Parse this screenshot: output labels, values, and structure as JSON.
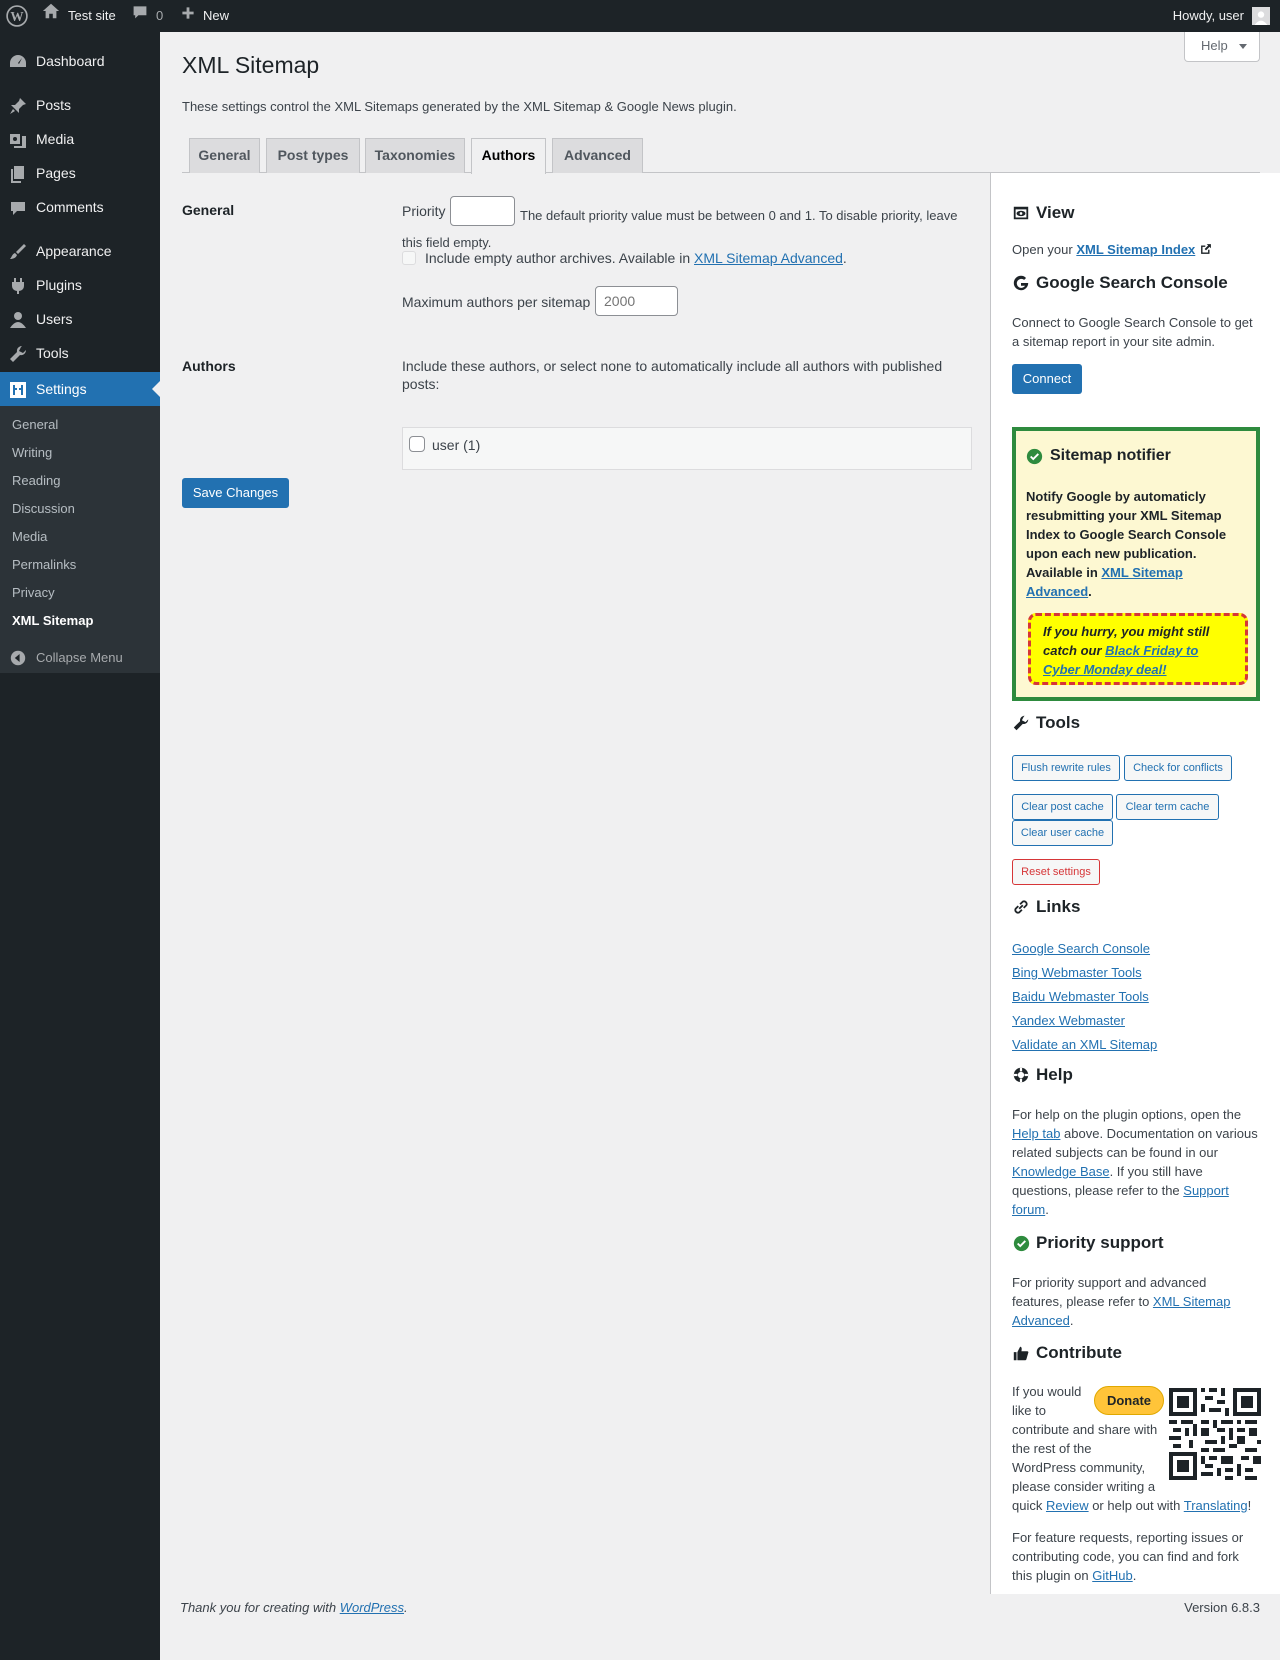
{
  "adminbar": {
    "site_name": "Test site",
    "comments_count": "0",
    "new_label": "New",
    "howdy": "Howdy, user"
  },
  "menu": {
    "items": [
      {
        "label": "Dashboard",
        "icon": "dashboard-icon"
      },
      {
        "label": "Posts",
        "icon": "pin-icon"
      },
      {
        "label": "Media",
        "icon": "media-icon"
      },
      {
        "label": "Pages",
        "icon": "pages-icon"
      },
      {
        "label": "Comments",
        "icon": "comment-icon"
      },
      {
        "label": "Appearance",
        "icon": "brush-icon"
      },
      {
        "label": "Plugins",
        "icon": "plug-icon"
      },
      {
        "label": "Users",
        "icon": "user-icon"
      },
      {
        "label": "Tools",
        "icon": "wrench-icon"
      },
      {
        "label": "Settings",
        "icon": "settings-icon"
      }
    ],
    "submenu": [
      "General",
      "Writing",
      "Reading",
      "Discussion",
      "Media",
      "Permalinks",
      "Privacy",
      "XML Sitemap"
    ],
    "collapse": "Collapse Menu"
  },
  "page": {
    "title": "XML Sitemap",
    "help": "Help",
    "intro": "These settings control the XML Sitemaps generated by the XML Sitemap & Google News plugin.",
    "tabs": [
      "General",
      "Post types",
      "Taxonomies",
      "Authors",
      "Advanced"
    ],
    "active_tab": "Authors"
  },
  "form": {
    "general_heading": "General",
    "priority_label": "Priority",
    "priority_value": "",
    "priority_desc_1": "The default priority value must be between 0 and 1. To disable priority, leave",
    "priority_desc_2": "this field empty.",
    "empty_archives_label": "Include empty author archives. Available in ",
    "empty_archives_link": "XML Sitemap Advanced",
    "empty_archives_end": ".",
    "max_label": "Maximum authors per sitemap",
    "max_placeholder": "2000",
    "authors_heading": "Authors",
    "authors_desc_1": "Include these authors, or select none to automatically include all authors with published",
    "authors_desc_2": "posts:",
    "author_item": "user (1)",
    "save": "Save Changes"
  },
  "sidebar": {
    "view_title": "View",
    "view_text": "Open your ",
    "view_link": "XML Sitemap Index",
    "gsc_title": "Google Search Console",
    "gsc_text_1": "Connect to Google Search Console to get",
    "gsc_text_2": "a sitemap report in your site admin.",
    "connect": "Connect",
    "notifier_title": "Sitemap notifier",
    "notifier_lines": [
      "Notify Google by automaticly",
      "resubmitting your XML Sitemap",
      "Index to Google Search Console",
      "upon each new publication."
    ],
    "notifier_avail": "Available in ",
    "notifier_link_1": "XML Sitemap",
    "notifier_link_2": "Advanced",
    "notifier_end": ".",
    "promo_1": "If you hurry, you might still",
    "promo_2": "catch our ",
    "promo_link_1": "Black Friday to",
    "promo_link_2": "Cyber Monday deal!",
    "tools_title": "Tools",
    "tools": {
      "flush": "Flush rewrite rules",
      "conflicts": "Check for conflicts",
      "post_cache": "Clear post cache",
      "term_cache": "Clear term cache",
      "user_cache": "Clear user cache",
      "reset": "Reset settings"
    },
    "links_title": "Links",
    "links": [
      "Google Search Console",
      "Bing Webmaster Tools",
      "Baidu Webmaster Tools",
      "Yandex Webmaster",
      "Validate an XML Sitemap"
    ],
    "help_title": "Help",
    "help_1": "For help on the plugin options, open the",
    "help_tab": "Help tab",
    "help_2": " above. Documentation on various",
    "help_3": "related subjects can be found in our",
    "help_kb": "Knowledge Base",
    "help_4": ". If you still have",
    "help_5": "questions, please refer to the ",
    "help_support_1": "Support",
    "help_support_2": "forum",
    "help_end": ".",
    "priority_title": "Priority support",
    "priority_1": "For priority support and advanced",
    "priority_2": "features, please refer to ",
    "priority_link_1": "XML Sitemap",
    "priority_link_2": "Advanced",
    "priority_end": ".",
    "contribute_title": "Contribute",
    "donate": "Donate",
    "contrib_lines": [
      "If you would",
      "like to",
      "contribute and share with",
      "the rest of the",
      "WordPress community,",
      "please consider writing a"
    ],
    "contrib_quick": "quick ",
    "review": "Review",
    "contrib_or": " or help out with ",
    "translating": "Translating",
    "contrib_end": "!",
    "feature_1": "For feature requests, reporting issues or",
    "feature_2": "contributing code, you can find and fork",
    "feature_3": "this plugin on ",
    "github": "GitHub",
    "feature_end": "."
  },
  "footer": {
    "thanks": "Thank you for creating with ",
    "wp": "WordPress",
    "thanks_end": ".",
    "version": "Version 6.8.3"
  },
  "colors": {
    "accent": "#2271b1",
    "menu_bg": "#1d2327",
    "notifier_border": "#2e8b3e",
    "promo_bg": "#ffff00",
    "reset": "#d63638"
  }
}
